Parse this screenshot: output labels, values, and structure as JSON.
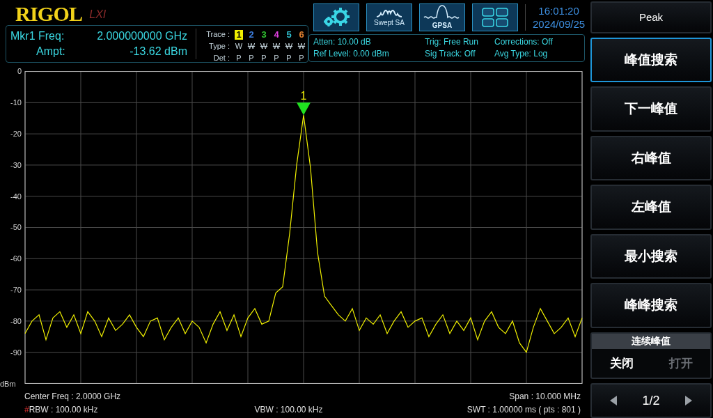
{
  "logo": {
    "brand": "RIGOL",
    "badge": "LXI"
  },
  "marker_readout": {
    "freq_label": "Mkr1 Freq:",
    "freq_value": "2.000000000 GHz",
    "ampt_label": "Ampt:",
    "ampt_value": "-13.62 dBm"
  },
  "traces": {
    "trace_label": "Trace :",
    "type_label": "Type :",
    "det_label": "Det :",
    "items": [
      {
        "number": "1",
        "color": "#f0f000",
        "selected": true,
        "type": "W",
        "blanked": false,
        "det": "P"
      },
      {
        "number": "2",
        "color": "#3d7fe0",
        "selected": false,
        "type": "W",
        "blanked": true,
        "det": "P"
      },
      {
        "number": "3",
        "color": "#30c030",
        "selected": false,
        "type": "W",
        "blanked": true,
        "det": "P"
      },
      {
        "number": "4",
        "color": "#e040e0",
        "selected": false,
        "type": "W",
        "blanked": true,
        "det": "P"
      },
      {
        "number": "5",
        "color": "#30c0d0",
        "selected": false,
        "type": "W",
        "blanked": true,
        "det": "P"
      },
      {
        "number": "6",
        "color": "#e08030",
        "selected": false,
        "type": "W",
        "blanked": true,
        "det": "P"
      }
    ]
  },
  "mode_buttons": [
    {
      "kind": "settings"
    },
    {
      "kind": "swept",
      "label": "Swept SA"
    },
    {
      "kind": "gpsa",
      "label": "GPSA"
    },
    {
      "kind": "layout"
    }
  ],
  "clock": {
    "time": "16:01:20",
    "date": "2024/09/25"
  },
  "settings": [
    [
      "Atten: 10.00 dB",
      "Ref Level: 0.00 dBm"
    ],
    [
      "Trig: Free Run",
      "Sig Track: Off"
    ],
    [
      "Corrections: Off",
      "Avg Type: Log"
    ]
  ],
  "chart_data": {
    "type": "line",
    "grid": true,
    "ylabel": "dBm",
    "ylim": [
      -100,
      0
    ],
    "yticks": [
      0,
      -10,
      -20,
      -30,
      -40,
      -50,
      -60,
      -70,
      -80,
      -90
    ],
    "series": [
      {
        "color": "#f0f000",
        "values": [
          -84,
          -80,
          -78,
          -86,
          -79,
          -77,
          -82,
          -78,
          -84,
          -77,
          -80,
          -85,
          -79,
          -83,
          -81,
          -78,
          -82,
          -85,
          -80,
          -79,
          -86,
          -82,
          -79,
          -84,
          -80,
          -82,
          -87,
          -81,
          -77,
          -83,
          -78,
          -85,
          -79,
          -76,
          -81,
          -80,
          -71,
          -69,
          -52,
          -30,
          -14,
          -31,
          -58,
          -72,
          -75,
          -78,
          -80,
          -76,
          -83,
          -79,
          -81,
          -78,
          -84,
          -80,
          -77,
          -82,
          -80,
          -79,
          -85,
          -81,
          -78,
          -84,
          -80,
          -83,
          -79,
          -86,
          -80,
          -77,
          -82,
          -84,
          -80,
          -87,
          -90,
          -82,
          -76,
          -80,
          -84,
          -82,
          -79,
          -85,
          -79
        ]
      }
    ]
  },
  "peak_marker": {
    "label": "1"
  },
  "status": {
    "center": "Center Freq : 2.0000 GHz",
    "span": "Span : 10.000 MHz",
    "rbw_flag": "#",
    "rbw": "RBW : 100.00 kHz",
    "vbw": "VBW : 100.00 kHz",
    "swt": "SWT : 1.00000 ms ( pts : 801 )"
  },
  "menu": {
    "title": "Peak",
    "buttons": [
      {
        "label": "峰值搜索",
        "selected": true
      },
      {
        "label": "下一峰值",
        "selected": false
      },
      {
        "label": "右峰值",
        "selected": false
      },
      {
        "label": "左峰值",
        "selected": false
      },
      {
        "label": "最小搜索",
        "selected": false
      },
      {
        "label": "峰峰搜索",
        "selected": false
      }
    ],
    "toggle": {
      "title": "连续峰值",
      "options": [
        {
          "label": "关闭",
          "selected": true
        },
        {
          "label": "打开",
          "selected": false
        }
      ]
    },
    "page": "1/2"
  }
}
